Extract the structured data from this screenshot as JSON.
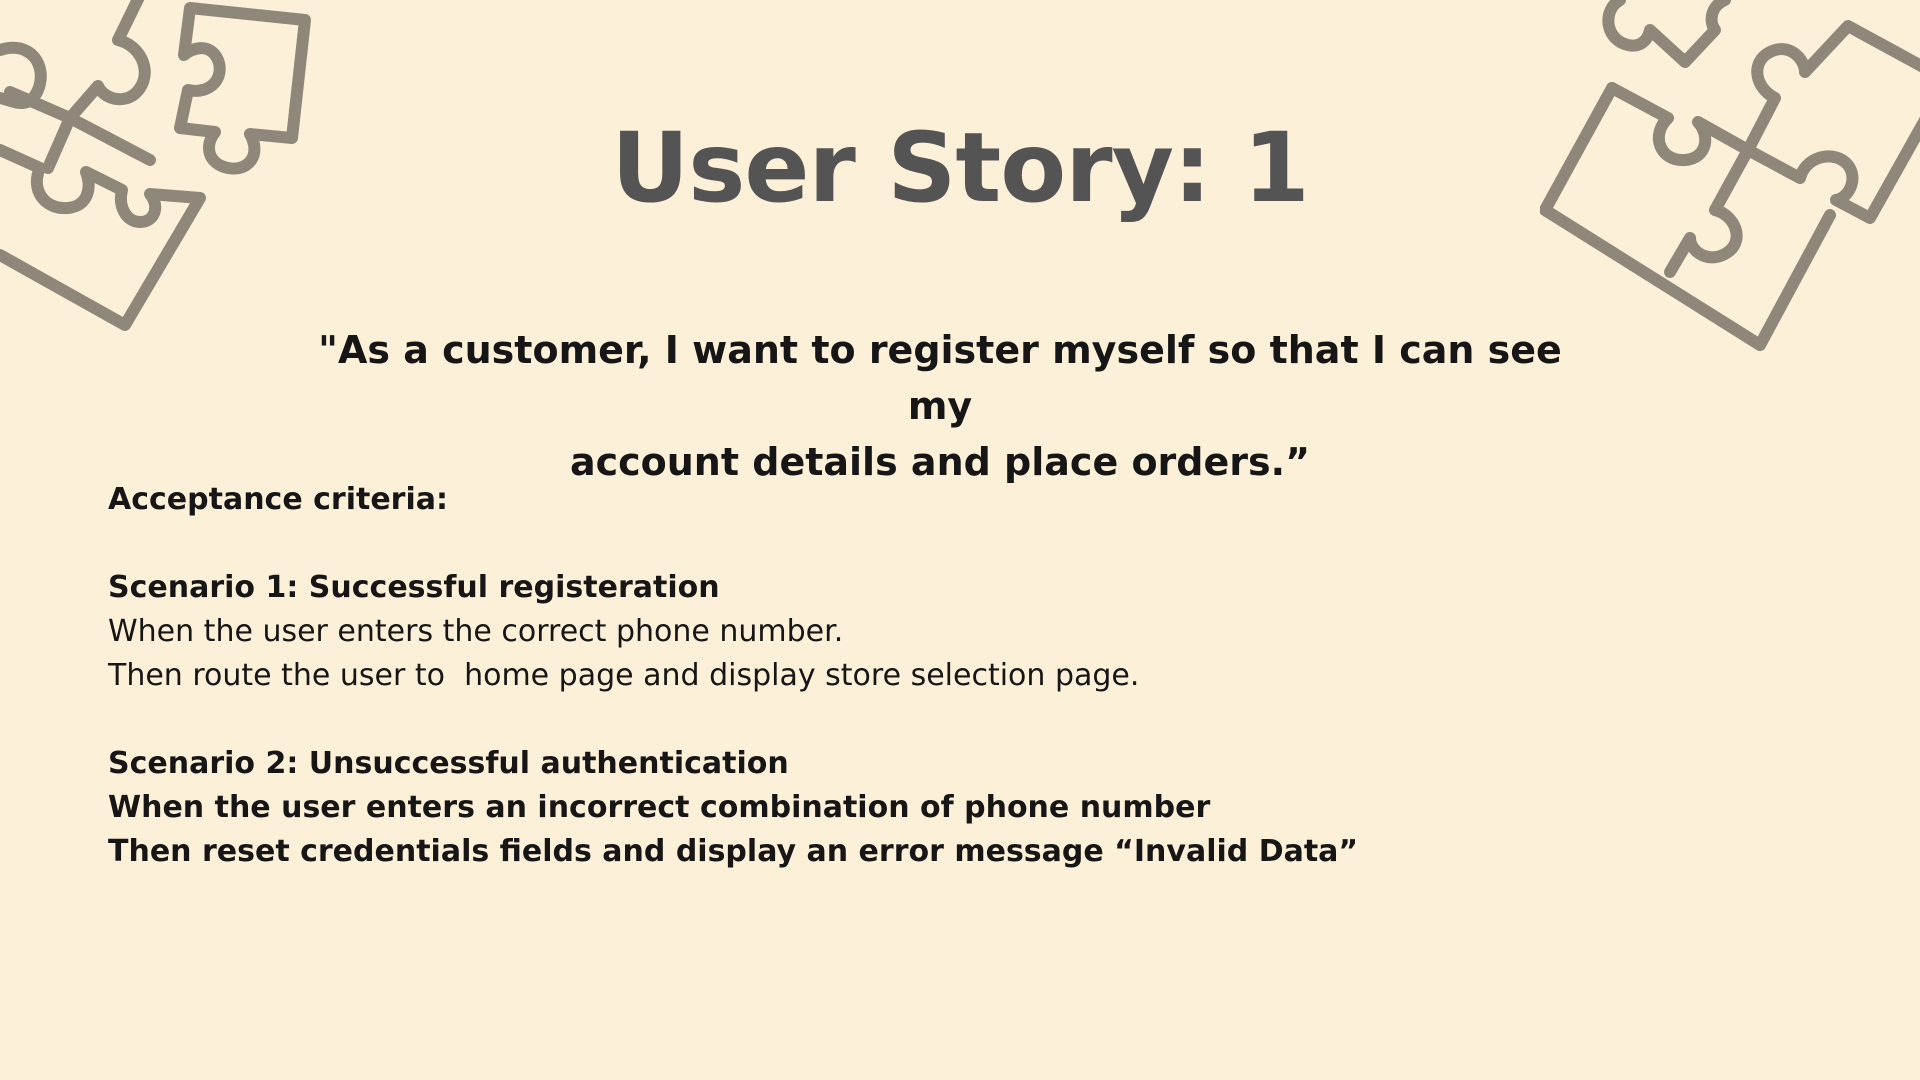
{
  "slide": {
    "title": "User Story: 1",
    "quote_line1": "\"As a customer, I want to register myself so that I can see my",
    "quote_line2": "account details and place orders.”",
    "acceptance_heading": "Acceptance criteria:",
    "scenario1": {
      "heading": "Scenario 1: Successful registeration",
      "when": "When the user enters the correct phone number.",
      "then": "Then route the user to  home page and display store selection page."
    },
    "scenario2": {
      "heading": "Scenario 2: Unsuccessful authentication",
      "when": "When the user enters an incorrect combination of phone number",
      "then": "Then reset credentials fields and display an error message “Invalid Data”"
    }
  },
  "decorations": {
    "left_icon": "puzzle-pieces-icon",
    "right_icon": "puzzle-pieces-icon",
    "icon_color": "#8e877a"
  },
  "colors": {
    "background": "#fdf0d8",
    "title": "#545454",
    "text": "#161616"
  }
}
